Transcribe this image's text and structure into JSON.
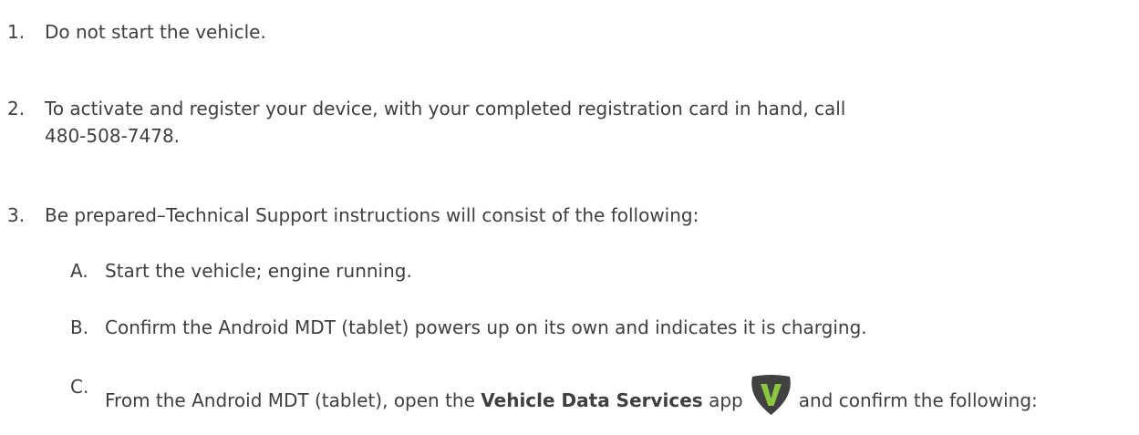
{
  "steps": [
    {
      "num": "1.",
      "text": "Do not start the vehicle."
    },
    {
      "num": "2.",
      "text_line1": "To activate and register your device, with your completed registration card in hand, call",
      "text_line2": "480-508-7478."
    },
    {
      "num": "3.",
      "text": "Be prepared–Technical Support instructions will consist of the following:"
    }
  ],
  "substeps": [
    {
      "num": "A.",
      "text": "Start the vehicle; engine running."
    },
    {
      "num": "B.",
      "text": "Confirm the Android MDT (tablet) powers up on its own and indicates it is charging."
    },
    {
      "num": "C.",
      "prefix": "From the Android MDT (tablet), open the ",
      "app_name": "Vehicle Data Services",
      "middle": " app",
      "suffix": "and confirm the following:"
    }
  ],
  "icon": {
    "name": "vehicle-data-services-app-icon",
    "letter": "V",
    "bg_color": "#414141",
    "letter_color": "#8cc63f"
  },
  "colors": {
    "text": "#3f3f3f",
    "background": "#ffffff"
  }
}
